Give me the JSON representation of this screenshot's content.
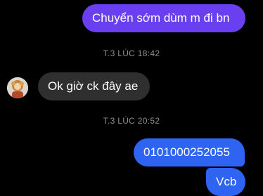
{
  "messages": [
    {
      "text": "Chuyển sớm dùm m đi bn"
    },
    {
      "timestamp": "T.3 LÚC 18:42"
    },
    {
      "text": "Ok giờ ck đây ae"
    },
    {
      "timestamp": "T.3 LÚC 20:52"
    },
    {
      "text": "0101000252055"
    },
    {
      "text": "Vcb"
    }
  ],
  "colors": {
    "outgoing_purple": "#6a3ff0",
    "outgoing_blue": "#2f63f2",
    "incoming": "#2f2f2f",
    "timestamp": "#8e8e93",
    "background": "#000000"
  },
  "icons": {
    "avatar": "contact-avatar-icon"
  }
}
